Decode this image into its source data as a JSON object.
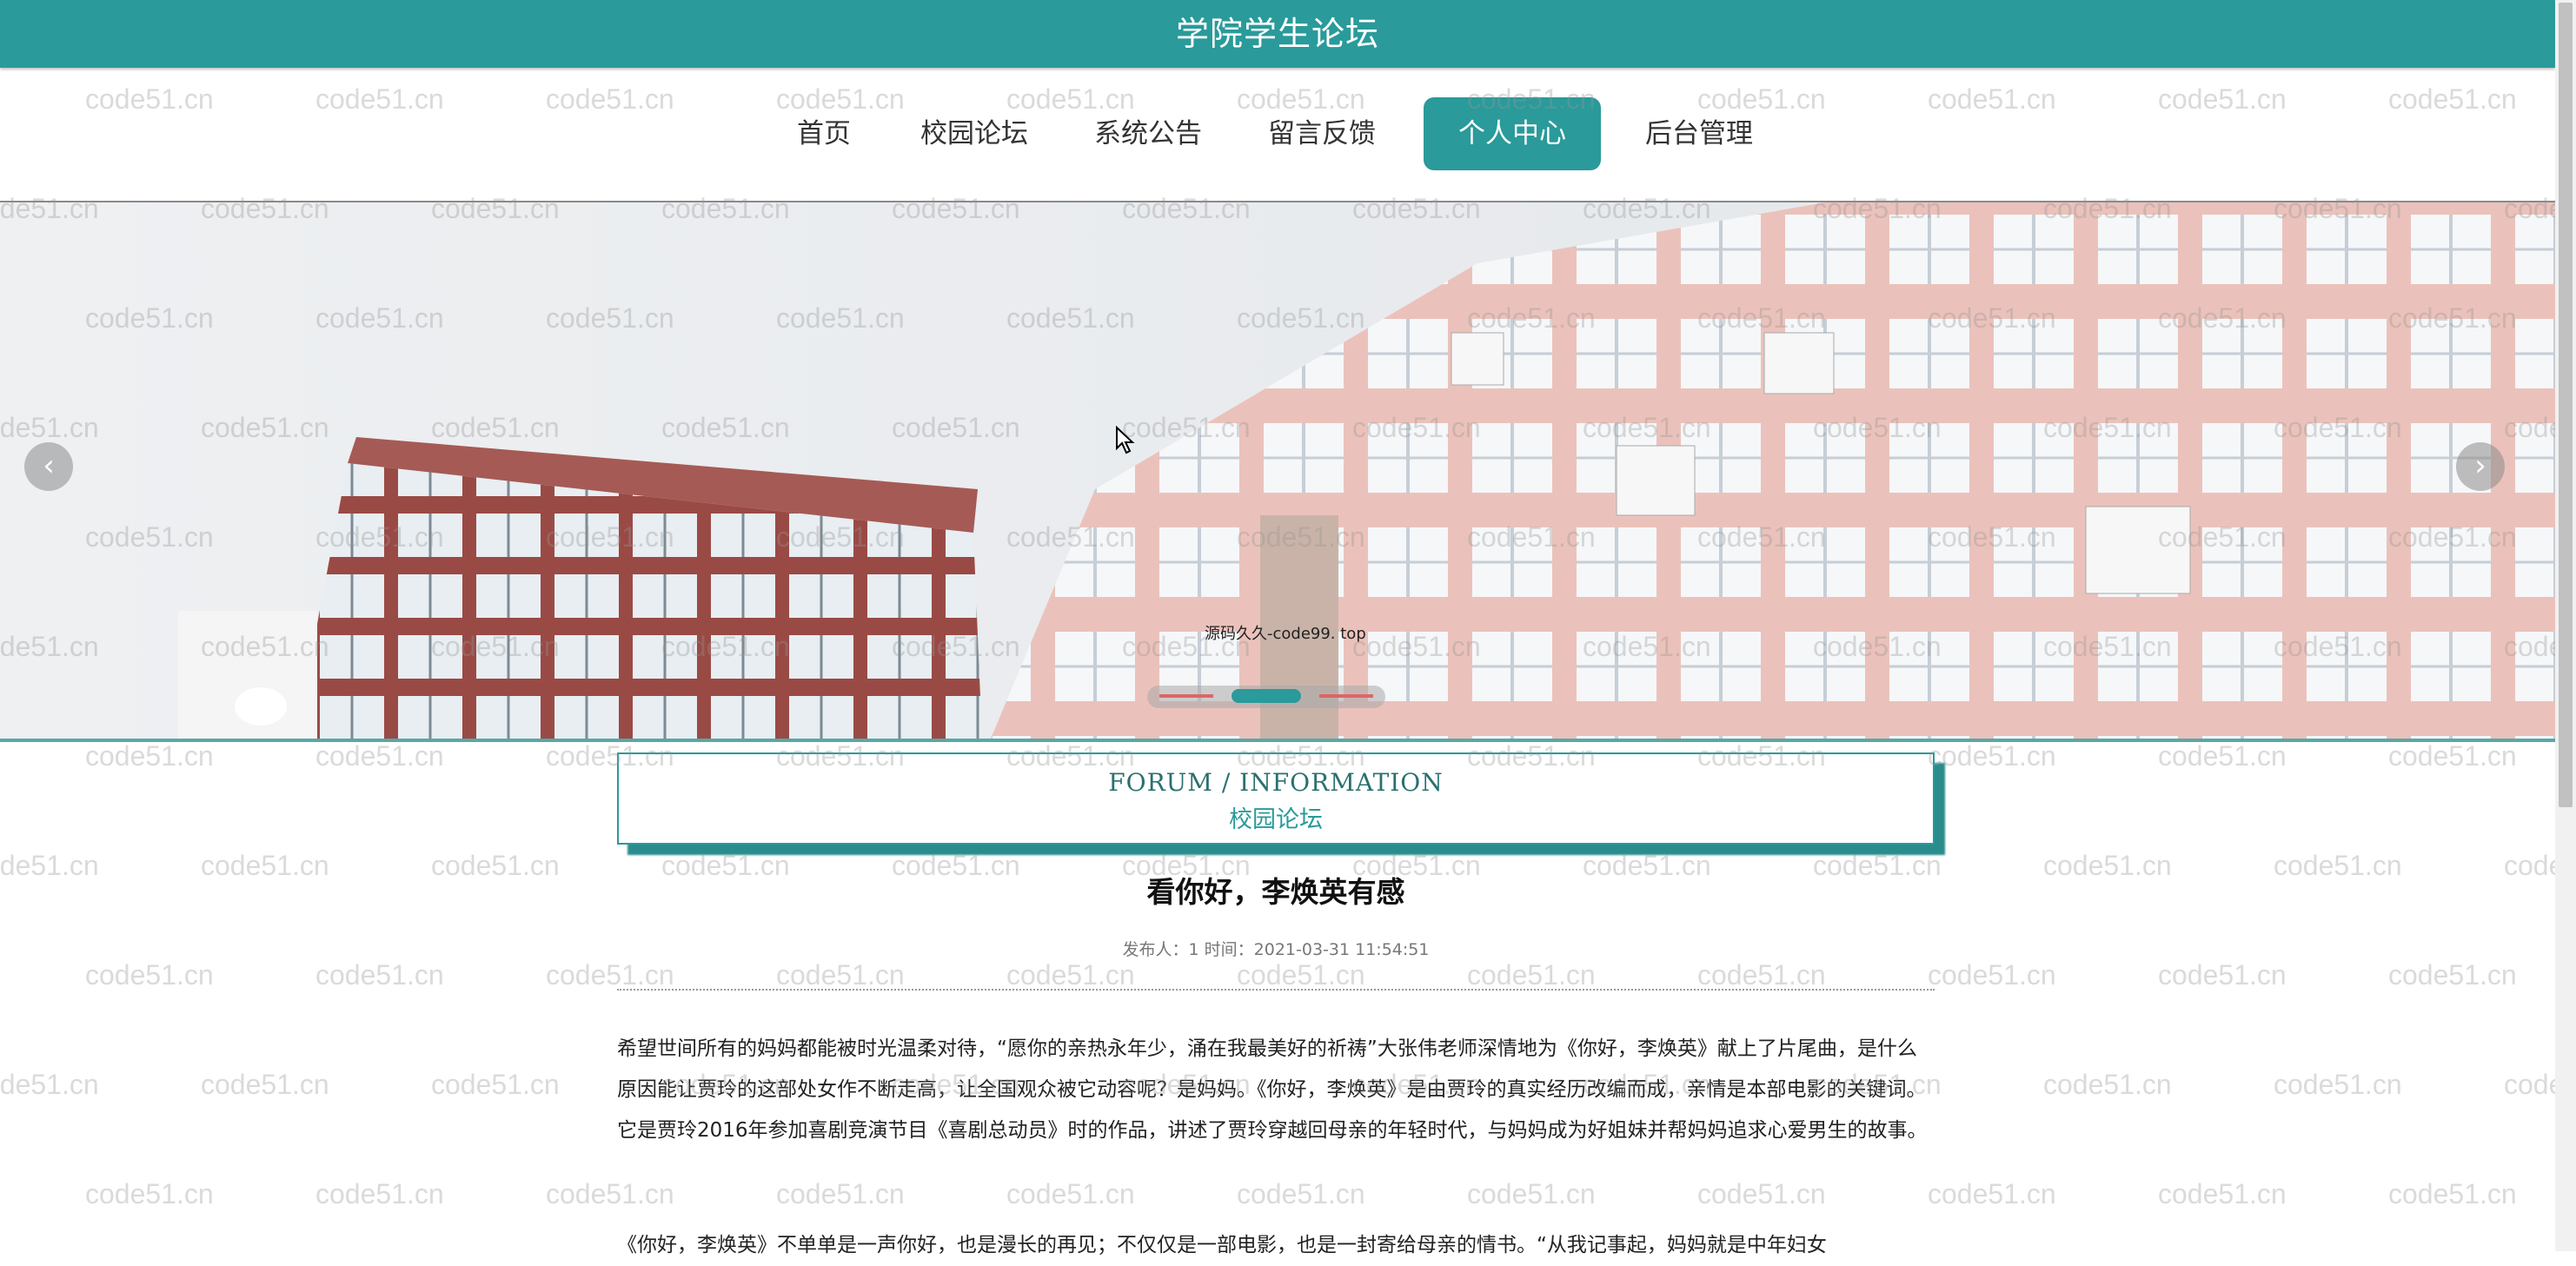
{
  "header": {
    "title": "学院学生论坛"
  },
  "nav": {
    "items": [
      {
        "label": "首页",
        "active": false
      },
      {
        "label": "校园论坛",
        "active": false
      },
      {
        "label": "系统公告",
        "active": false
      },
      {
        "label": "留言反馈",
        "active": false
      },
      {
        "label": "个人中心",
        "active": true
      },
      {
        "label": "后台管理",
        "active": false
      }
    ]
  },
  "banner": {
    "caption": "源码久久-code99. top",
    "prev_icon": "chevron-left-icon",
    "next_icon": "chevron-right-icon",
    "active_slide_index": 1,
    "slide_count": 3
  },
  "section": {
    "title_en": "FORUM / INFORMATION",
    "title_cn": "校园论坛"
  },
  "article": {
    "title": "看你好，李焕英有感",
    "meta": "发布人：1 时间：2021-03-31 11:54:51",
    "paragraphs": [
      "希望世间所有的妈妈都能被时光温柔对待，“愿你的亲热永年少，涌在我最美好的祈祷”大张伟老师深情地为《你好，李焕英》献上了片尾曲，是什么原因能让贾玲的这部处女作不断走高，让全国观众被它动容呢？是妈妈。《你好，李焕英》是由贾玲的真实经历改编而成，亲情是本部电影的关键词。它是贾玲2016年参加喜剧竞演节目《喜剧总动员》时的作品，讲述了贾玲穿越回母亲的年轻时代，与妈妈成为好姐妹并帮妈妈追求心爱男生的故事。",
      "《你好，李焕英》不单单是一声你好，也是漫长的再见；不仅仅是一部电影，也是一封寄给母亲的情书。“从我记事起，妈妈就是中年妇女"
    ]
  },
  "watermark": {
    "text": "code51.cn"
  },
  "colors": {
    "accent": "#2a9a9a",
    "watermark": "#969696"
  }
}
